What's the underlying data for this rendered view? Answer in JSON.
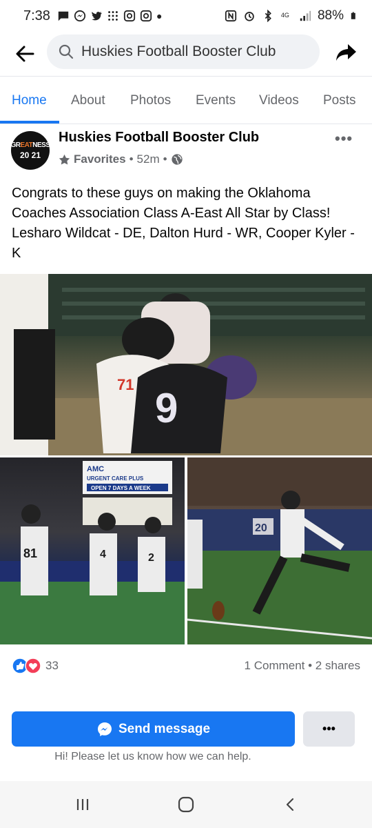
{
  "status": {
    "time": "7:38",
    "battery": "88%",
    "network": "4G"
  },
  "search": {
    "text": "Huskies Football Booster Club"
  },
  "tabs": [
    {
      "label": "Home"
    },
    {
      "label": "About"
    },
    {
      "label": "Photos"
    },
    {
      "label": "Events"
    },
    {
      "label": "Videos"
    },
    {
      "label": "Posts"
    }
  ],
  "post": {
    "page_name": "Huskies Football Booster Club",
    "avatar_line1_a": "GR",
    "avatar_line1_b": "EAT",
    "avatar_line1_c": "NESS",
    "avatar_line2": "20 21",
    "favorites": "Favorites",
    "time": "52m",
    "text": "Congrats to these guys on making the Oklahoma Coaches Association Class A-East All Star by Class! Lesharo Wildcat - DE, Dalton Hurd - WR, Cooper Kyler - K",
    "reactions_count": "33",
    "comments_shares": "1 Comment • 2 shares",
    "photo_main_numbers": [
      "71",
      "9"
    ],
    "photo_left_signs": [
      "AMC",
      "URGENT CARE PLUS",
      "OPEN 7 DAYS A WEEK"
    ],
    "photo_left_numbers": [
      "81",
      "4",
      "2"
    ],
    "photo_right_number": "20"
  },
  "cta": {
    "send_label": "Send message",
    "more_label": "•••",
    "help_text": "Hi! Please let us know how we can help."
  },
  "colors": {
    "accent": "#1877f2",
    "secondary_text": "#65676b",
    "like_blue": "#1877f2",
    "love_red": "#f33e58"
  }
}
